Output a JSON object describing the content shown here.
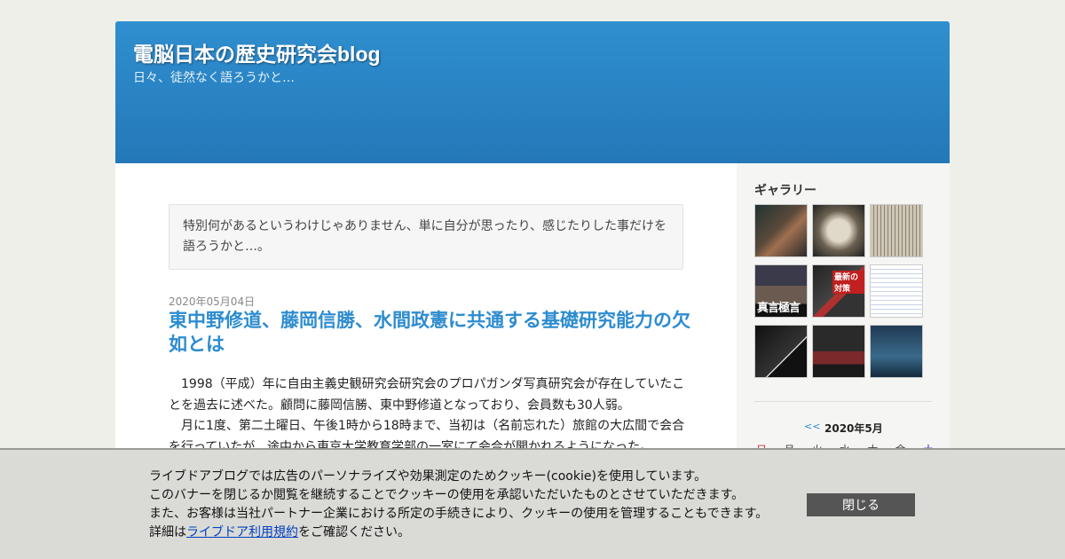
{
  "header": {
    "title": "電脳日本の歴史研究会blog",
    "description": "日々、徒然なく語ろうかと…"
  },
  "intro": {
    "text": "特別何があるというわけじゃありません、単に自分が思ったり、感じたりした事だけを語ろうかと…。"
  },
  "post": {
    "date": "2020年05月04日",
    "title": "東中野修道、藤岡信勝、水間政憲に共通する基礎研究能力の欠如とは",
    "paragraphs": [
      "1998（平成）年に自由主義史観研究会研究会のプロパガンダ写真研究会が存在していたことを過去に述べた。顧問に藤岡信勝、東中野修道となっており、会員数も30人弱。",
      "月に1度、第二土曜日、午後1時から18時まで、当初は（名前忘れた）旅館の大広間で会合を行っていたが、途中から東京大学教育学部の一室にて会合が開かれるようになった。"
    ]
  },
  "sidebar": {
    "gallery_heading": "ギャラリー",
    "thumbnails": [
      {
        "caption": ""
      },
      {
        "caption": ""
      },
      {
        "caption": ""
      },
      {
        "caption": "真言極言",
        "tag": ""
      },
      {
        "caption": "",
        "tag": "最新の対策"
      },
      {
        "caption": ""
      },
      {
        "caption": ""
      },
      {
        "caption": ""
      },
      {
        "caption": ""
      }
    ],
    "calendar": {
      "prev": "<<",
      "month": "2020年5月",
      "days": [
        "日",
        "月",
        "火",
        "水",
        "木",
        "金",
        "土"
      ]
    }
  },
  "cookie": {
    "lines": [
      "ライブドアブログでは広告のパーソナライズや効果測定のためクッキー(cookie)を使用しています。",
      "このバナーを閉じるか閲覧を継続することでクッキーの使用を承認いただいたものとさせていただきます。",
      "また、お客様は当社パートナー企業における所定の手続きにより、クッキーの使用を管理することもできます。"
    ],
    "detail_prefix": "詳細は",
    "link_text": "ライブドア利用規約",
    "detail_suffix": "をご確認ください。",
    "close_label": "閉じる"
  }
}
